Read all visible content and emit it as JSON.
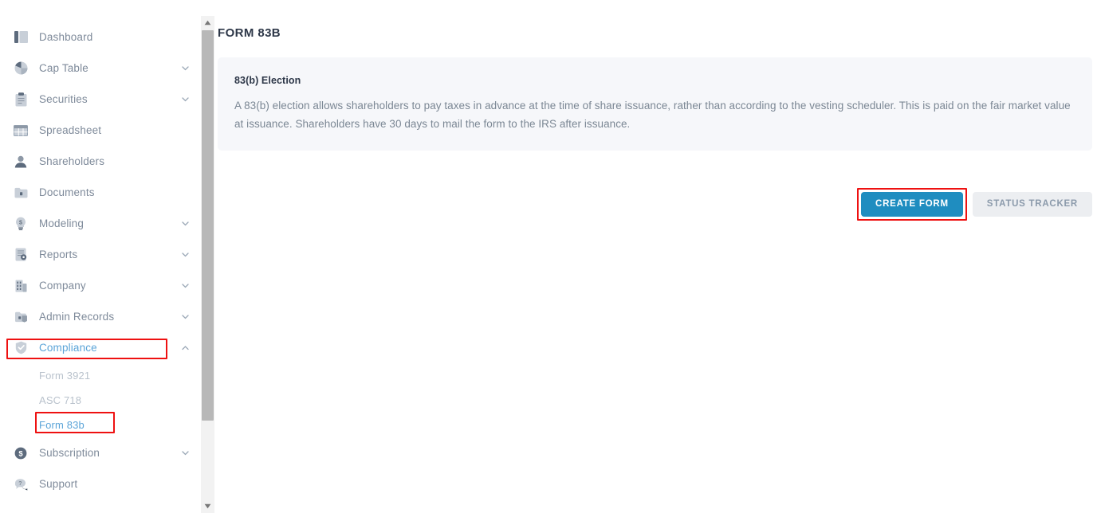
{
  "sidebar": {
    "items": [
      {
        "label": "Dashboard",
        "icon": "dashboard-icon",
        "expandable": false,
        "active": false
      },
      {
        "label": "Cap Table",
        "icon": "pie-chart-icon",
        "expandable": true,
        "active": false
      },
      {
        "label": "Securities",
        "icon": "clipboard-icon",
        "expandable": true,
        "active": false
      },
      {
        "label": "Spreadsheet",
        "icon": "spreadsheet-icon",
        "expandable": false,
        "active": false
      },
      {
        "label": "Shareholders",
        "icon": "person-icon",
        "expandable": false,
        "active": false
      },
      {
        "label": "Documents",
        "icon": "folder-icon",
        "expandable": false,
        "active": false
      },
      {
        "label": "Modeling",
        "icon": "lightbulb-icon",
        "expandable": true,
        "active": false
      },
      {
        "label": "Reports",
        "icon": "report-gear-icon",
        "expandable": true,
        "active": false
      },
      {
        "label": "Company",
        "icon": "building-icon",
        "expandable": true,
        "active": false
      },
      {
        "label": "Admin Records",
        "icon": "folder-lock-icon",
        "expandable": true,
        "active": false
      },
      {
        "label": "Compliance",
        "icon": "shield-check-icon",
        "expandable": true,
        "active": true
      },
      {
        "label": "Subscription",
        "icon": "dollar-circle-icon",
        "expandable": true,
        "active": false
      },
      {
        "label": "Support",
        "icon": "chat-help-icon",
        "expandable": false,
        "active": false
      }
    ],
    "compliance_children": [
      {
        "label": "Form 3921",
        "active": false
      },
      {
        "label": "ASC 718",
        "active": false
      },
      {
        "label": "Form 83b",
        "active": true
      }
    ]
  },
  "main": {
    "page_title": "FORM 83B",
    "info": {
      "heading": "83(b) Election",
      "body": "A 83(b) election allows shareholders to pay taxes in advance at the time of share issuance, rather than according to the vesting scheduler. This is paid on the fair market value at issuance. Shareholders have 30 days to mail the form to the IRS after issuance."
    },
    "actions": {
      "create_form": "CREATE FORM",
      "status_tracker": "STATUS TRACKER"
    }
  },
  "scrollbar": {
    "up_arrow": "▲",
    "down_arrow": "▼"
  },
  "colors": {
    "accent_blue": "#1f8dc0",
    "link_blue": "#5ba4d8",
    "annotation_red": "#ee1111",
    "panel_bg": "#f6f7fa",
    "muted_text": "#7b8794"
  }
}
